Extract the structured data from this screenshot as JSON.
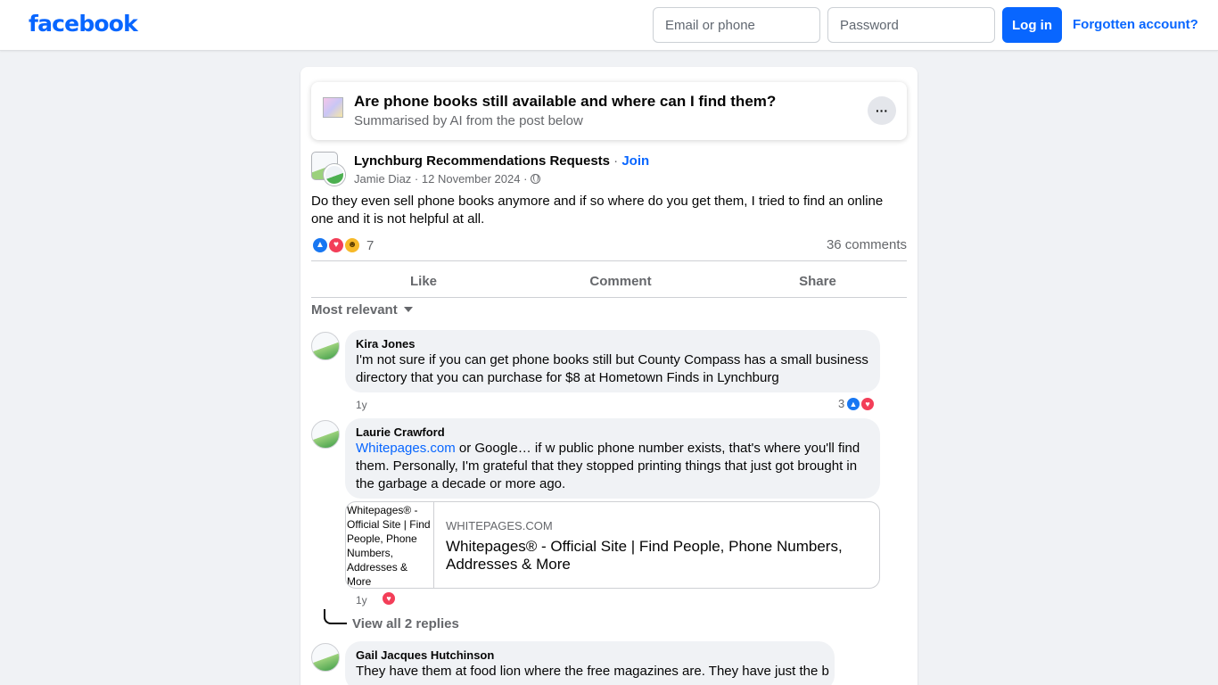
{
  "header": {
    "logo": "facebook",
    "email_placeholder": "Email or phone",
    "password_placeholder": "Password",
    "login_label": "Log in",
    "forgot_label": "Forgotten account?"
  },
  "ai_summary": {
    "title": "Are phone books still available and where can I find them?",
    "subtitle": "Summarised by AI from the post below",
    "more_label": "···"
  },
  "post": {
    "group_name": "Lynchburg Recommendations Requests",
    "separator": "·",
    "join_label": "Join",
    "author": "Jamie Diaz",
    "date": "12 November 2024",
    "text": "Do they even sell phone books anymore and if so where do you get them, I tried to find an online one and it is not helpful at all.",
    "reaction_count": "7",
    "comment_count": "36 comments",
    "actions": {
      "like": "Like",
      "comment": "Comment",
      "share": "Share"
    },
    "sort_label": "Most relevant"
  },
  "comments": [
    {
      "name": "Kira Jones",
      "text": "I'm not sure if you can get phone books still but County Compass has a small business directory that you can purchase for $8 at Hometown Finds in Lynchburg",
      "time": "1y",
      "reaction_count": "3"
    },
    {
      "name": "Laurie Crawford",
      "link_text": "Whitepages.com",
      "text": " or Google… if w public phone number exists, that's where you'll find them. Personally, I'm grateful that they stopped printing things that just got brought in the garbage a decade or more ago.",
      "time": "1y",
      "link_preview": {
        "image_alt": "Whitepages® - Official Site | Find People, Phone Numbers, Addresses & More",
        "domain": "WHITEPAGES.COM",
        "title": "Whitepages® - Official Site | Find People, Phone Numbers, Addresses & More"
      },
      "view_replies": "View all 2 replies"
    },
    {
      "name": "Gail Jacques Hutchinson",
      "text": "They have them at food lion where the free magazines are. They have just the b"
    }
  ],
  "colors": {
    "brand": "#0866ff",
    "background": "#f0f2f5",
    "secondary_text": "#65676b",
    "like": "#1877f2",
    "love": "#f33e58",
    "haha": "#f7b928"
  },
  "icons": {
    "like": "thumbs-up-icon",
    "love": "heart-icon",
    "haha": "laughing-face-icon",
    "globe": "globe-icon",
    "caret": "caret-down-icon"
  }
}
